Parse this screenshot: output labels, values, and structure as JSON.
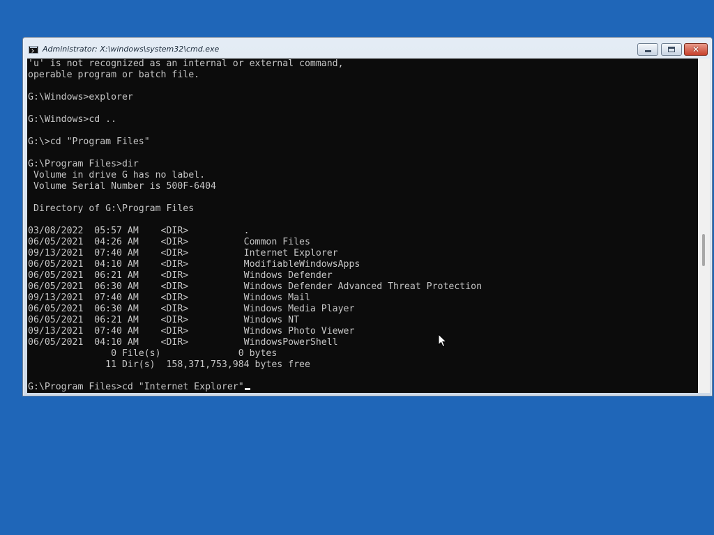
{
  "window": {
    "title": "Administrator: X:\\windows\\system32\\cmd.exe",
    "close_glyph": "✕"
  },
  "console": {
    "lines": [
      "'u' is not recognized as an internal or external command,",
      "operable program or batch file.",
      "",
      "G:\\Windows>explorer",
      "",
      "G:\\Windows>cd ..",
      "",
      "G:\\>cd \"Program Files\"",
      "",
      "G:\\Program Files>dir",
      " Volume in drive G has no label.",
      " Volume Serial Number is 500F-6404",
      "",
      " Directory of G:\\Program Files",
      "",
      "03/08/2022  05:57 AM    <DIR>          .",
      "06/05/2021  04:26 AM    <DIR>          Common Files",
      "09/13/2021  07:40 AM    <DIR>          Internet Explorer",
      "06/05/2021  04:10 AM    <DIR>          ModifiableWindowsApps",
      "06/05/2021  06:21 AM    <DIR>          Windows Defender",
      "06/05/2021  06:30 AM    <DIR>          Windows Defender Advanced Threat Protection",
      "09/13/2021  07:40 AM    <DIR>          Windows Mail",
      "06/05/2021  06:30 AM    <DIR>          Windows Media Player",
      "06/05/2021  06:21 AM    <DIR>          Windows NT",
      "09/13/2021  07:40 AM    <DIR>          Windows Photo Viewer",
      "06/05/2021  04:10 AM    <DIR>          WindowsPowerShell",
      "               0 File(s)              0 bytes",
      "              11 Dir(s)  158,371,753,984 bytes free",
      ""
    ],
    "input_line": "G:\\Program Files>cd \"Internet Explorer\""
  },
  "colors": {
    "desktop": "#1f66b8",
    "console_bg": "#0c0c0c",
    "console_text": "#c6c6c6"
  },
  "icons": {
    "app": "cmd-icon",
    "minimize": "minimize-icon",
    "maximize": "maximize-icon",
    "close": "close-icon",
    "pointer": "mouse-pointer-icon"
  }
}
